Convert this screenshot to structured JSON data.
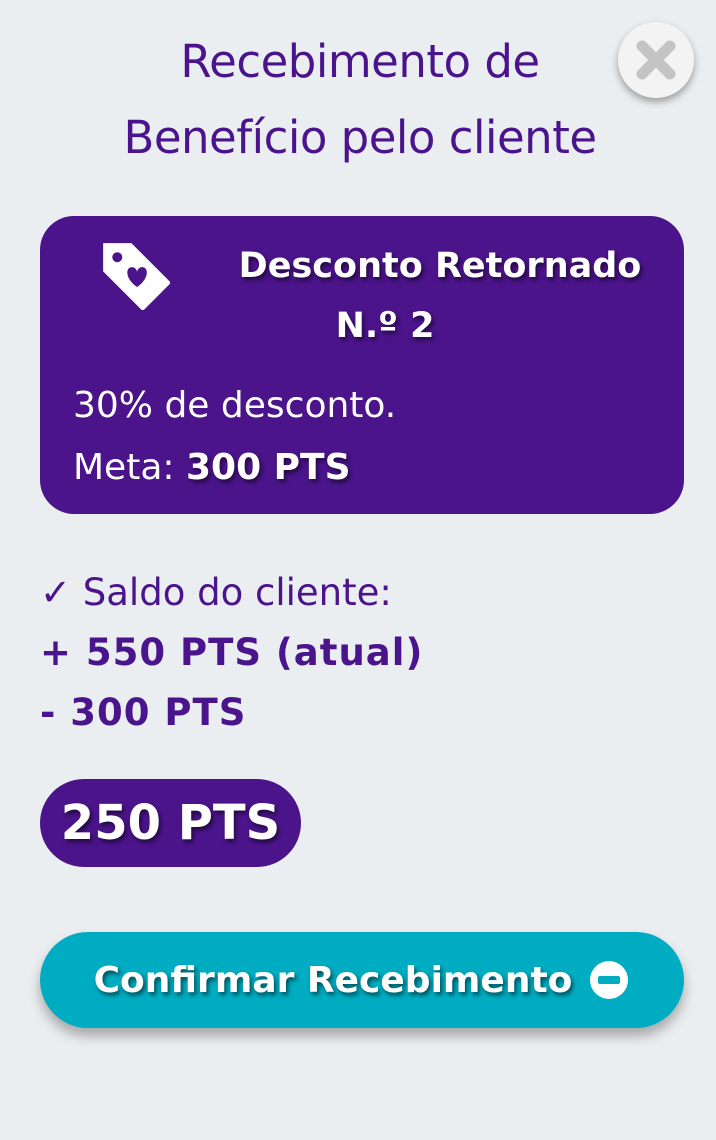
{
  "header": {
    "title_line1": "Recebimento de",
    "title_line2": "Benefício pelo cliente",
    "close_icon": "close-icon"
  },
  "benefit": {
    "icon": "heart-tag-icon",
    "title_line1": "Desconto Retornado",
    "title_line2": "N.º 2",
    "description": "30% de desconto.",
    "meta_label": "Meta:",
    "meta_value": "300 PTS"
  },
  "balance": {
    "line1": "✓ Saldo do cliente:",
    "line2": "+ 550 PTS (atual)",
    "line3": "- 300 PTS",
    "result": "250 PTS"
  },
  "actions": {
    "confirm_label": "Confirmar Recebimento",
    "confirm_icon": "minus-circle-icon"
  },
  "colors": {
    "background": "#ebeef0",
    "primary": "#4b148b",
    "accent": "#00acc1"
  }
}
